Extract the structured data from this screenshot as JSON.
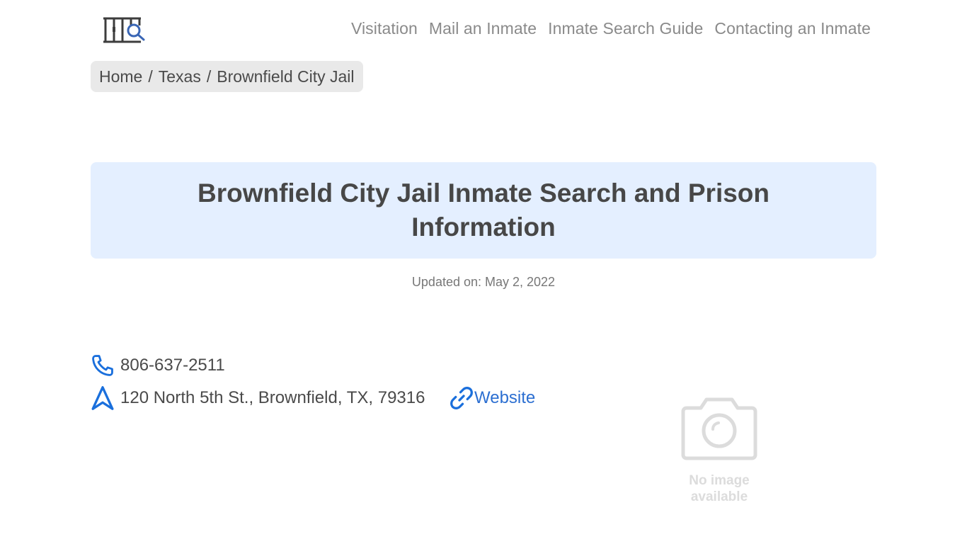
{
  "header": {
    "logo_icon": "jail-bars-search-icon",
    "nav": [
      {
        "label": "Visitation"
      },
      {
        "label": "Mail an Inmate"
      },
      {
        "label": "Inmate Search Guide"
      },
      {
        "label": "Contacting an Inmate"
      }
    ]
  },
  "breadcrumb": {
    "items": [
      "Home",
      "Texas",
      "Brownfield City Jail"
    ],
    "separator": "/"
  },
  "main": {
    "title": "Brownfield City Jail Inmate Search and Prison Information",
    "updated": "Updated on: May 2, 2022",
    "contact": {
      "phone": "806-637-2511",
      "address": "120 North 5th St., Brownfield, TX, 79316",
      "website_label": "Website",
      "phone_icon": "phone-icon",
      "address_icon": "navigation-arrow-icon",
      "website_icon": "link-icon"
    },
    "placeholder_image": {
      "icon": "camera-icon",
      "line1": "No image",
      "line2": "available"
    },
    "colors": {
      "accent": "#1a6fdc",
      "hero_bg": "#e4efff",
      "breadcrumb_bg": "#e9e9e9",
      "link": "#2c6fd1"
    }
  }
}
